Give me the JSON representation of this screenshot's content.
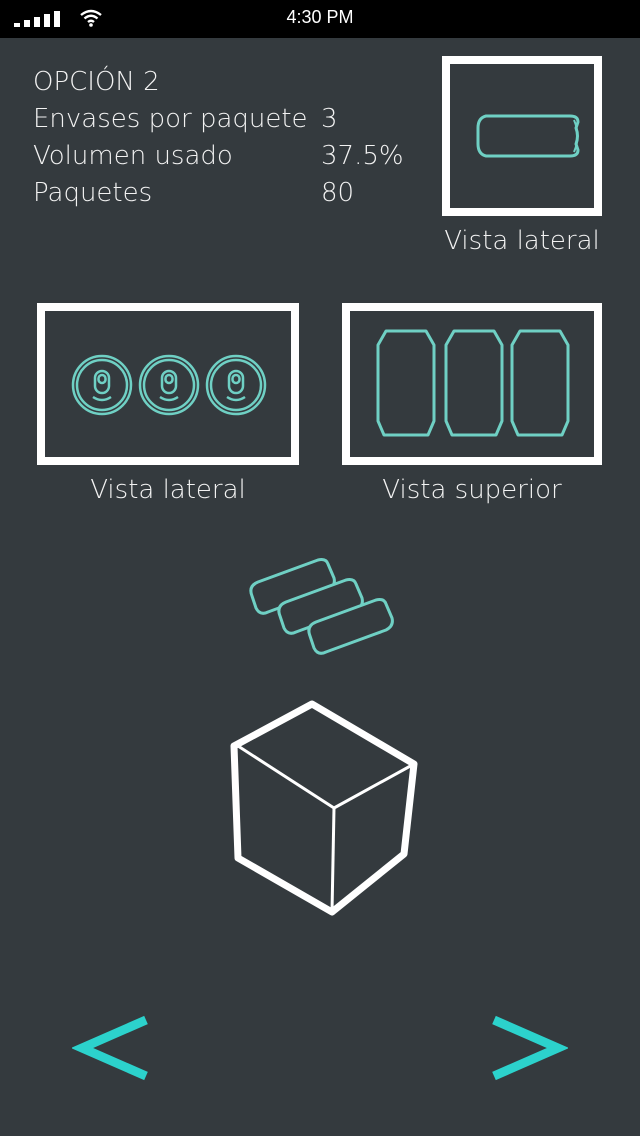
{
  "status_bar": {
    "time": "4:30 PM",
    "signal_icon": "signal-bars-icon",
    "wifi_icon": "wifi-icon"
  },
  "option": {
    "title": "OPCIÓN 2",
    "rows": [
      {
        "label": "Envases por paquete",
        "value": "3"
      },
      {
        "label": "Volumen usado",
        "value": "37.5%"
      },
      {
        "label": "Paquetes",
        "value": "80"
      }
    ]
  },
  "views": {
    "single_side_caption": "Vista lateral",
    "pack_side_caption": "Vista lateral",
    "pack_top_caption": "Vista superior"
  },
  "icons": {
    "single_can": "can-side-icon",
    "cans_top": "cans-top-icon",
    "cans_side": "cans-front-icon",
    "cans_stack": "cans-stack-icon",
    "box": "cube-box-icon"
  },
  "navigation": {
    "prev_icon": "chevron-left-icon",
    "next_icon": "chevron-right-icon"
  },
  "colors": {
    "background": "#343a3e",
    "accent": "#6fd0c4",
    "nav_accent": "#2cd2cc",
    "frame": "#ffffff"
  }
}
